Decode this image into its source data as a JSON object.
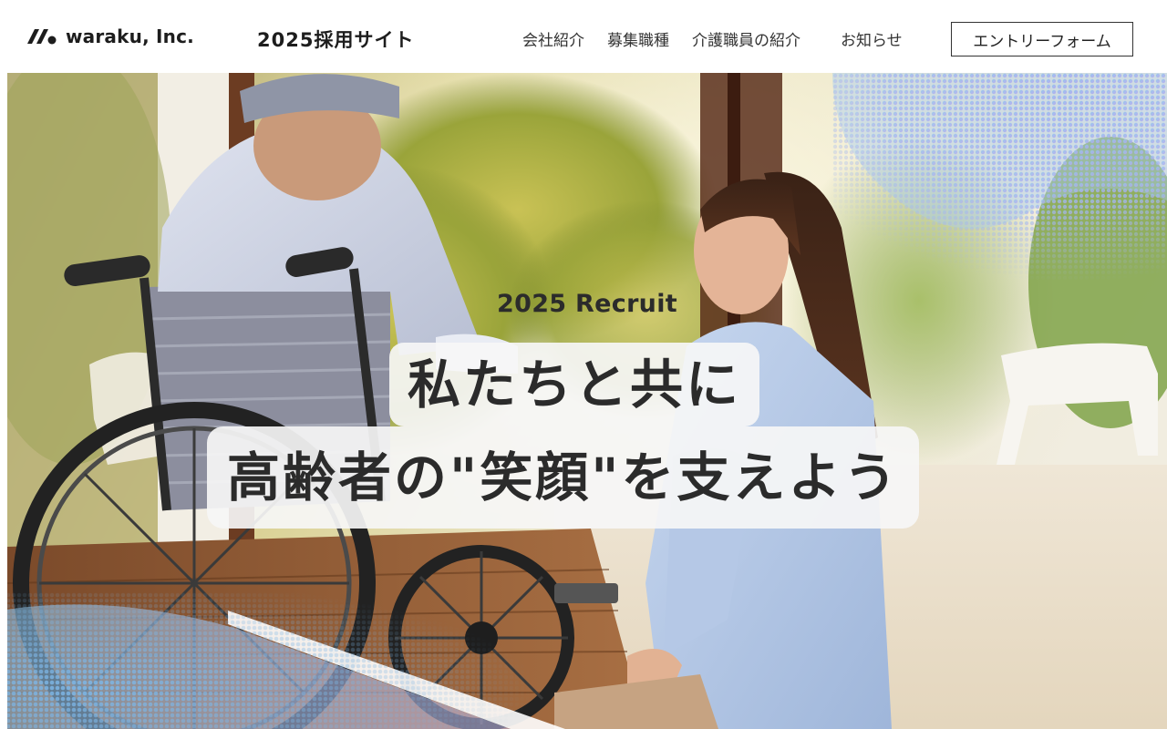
{
  "header": {
    "logo_text": "waraku, Inc.",
    "site_title": "2025採用サイト",
    "nav": [
      {
        "label": "会社紹介"
      },
      {
        "label": "募集職種"
      },
      {
        "label": "介護職員の紹介"
      },
      {
        "label": "お知らせ"
      }
    ],
    "entry_button": "エントリーフォーム"
  },
  "hero": {
    "subtitle": "2025 Recruit",
    "line1": "私たちと共に",
    "line2": "高齢者の\"笑顔\"を支えよう"
  },
  "colors": {
    "text_dark": "#2b2b2b",
    "header_bg": "#ffffff",
    "dot_accent_blue": "#8fc7ee",
    "dot_accent_purple": "#b9a6f0",
    "caption_bg": "#f6f6f6"
  }
}
